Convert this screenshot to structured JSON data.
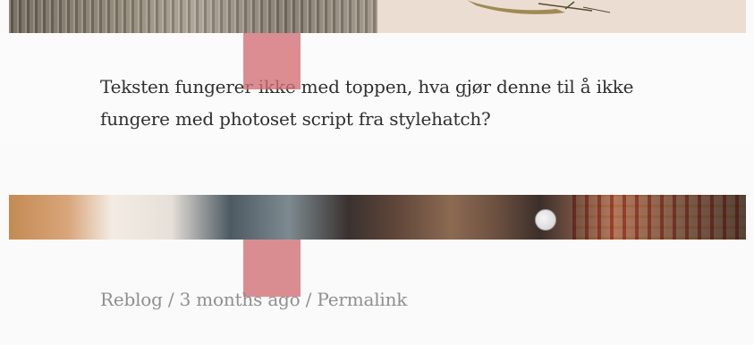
{
  "post": {
    "text": "Teksten fungerer ikke med toppen, hva gjør denne til å ikke fungere med photoset script fra stylehatch?"
  },
  "meta": {
    "reblog": "Reblog",
    "separator": " / ",
    "time": "3 months ago",
    "permalink": "Permalink"
  }
}
